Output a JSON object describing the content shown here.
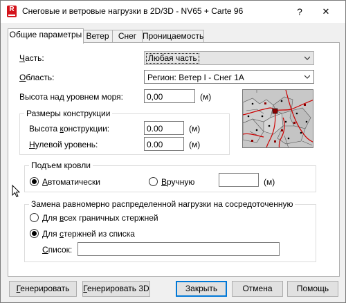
{
  "window": {
    "title": "Снеговые и ветровые нагрузки в 2D/3D - NV65 + Carte 96",
    "help_label": "?",
    "close_label": "✕",
    "app_icon_letter": "R"
  },
  "tabs": [
    {
      "label": "Общие параметры",
      "active": true
    },
    {
      "label": "Ветер",
      "active": false
    },
    {
      "label": "Снег",
      "active": false
    },
    {
      "label": "Проницаемость",
      "active": false
    }
  ],
  "general": {
    "part_label": "Часть:",
    "part_value": "Любая часть",
    "region_label": "Область:",
    "region_value": "Регион: Ветер I - Снег 1A",
    "altitude_label": "Высота над уровнем моря:",
    "altitude_value": "0,00",
    "altitude_unit": "(м)"
  },
  "dimensions": {
    "group_title": "Размеры конструкции",
    "height_label": "Высота конструкции:",
    "height_value": "0.00",
    "height_unit": "(м)",
    "zero_label": "Нулевой уровень:",
    "zero_value": "0.00",
    "zero_unit": "(м)"
  },
  "roof": {
    "group_title": "Подъем кровли",
    "auto_label": "Автоматически",
    "auto_selected": true,
    "manual_label": "Вручную",
    "manual_selected": false,
    "manual_value": "",
    "unit": "(м)"
  },
  "replace": {
    "group_title": "Замена равномерно распределенной нагрузки на сосредоточенную",
    "all_label": "Для всех граничных стержней",
    "all_selected": false,
    "list_option_label": "Для стержней из списка",
    "list_option_selected": true,
    "list_label": "Список:",
    "list_value": ""
  },
  "buttons": {
    "generate": "Генерировать",
    "generate3d": "Генерировать 3D",
    "close": "Закрыть",
    "cancel": "Отмена",
    "help": "Помощь"
  },
  "colors": {
    "app_icon": "#d4131b",
    "default_button_border": "#0078d7",
    "map_background": "#c8c8c8",
    "map_region_lines": "#cc0000",
    "map_selected_region": "#8b0000"
  }
}
